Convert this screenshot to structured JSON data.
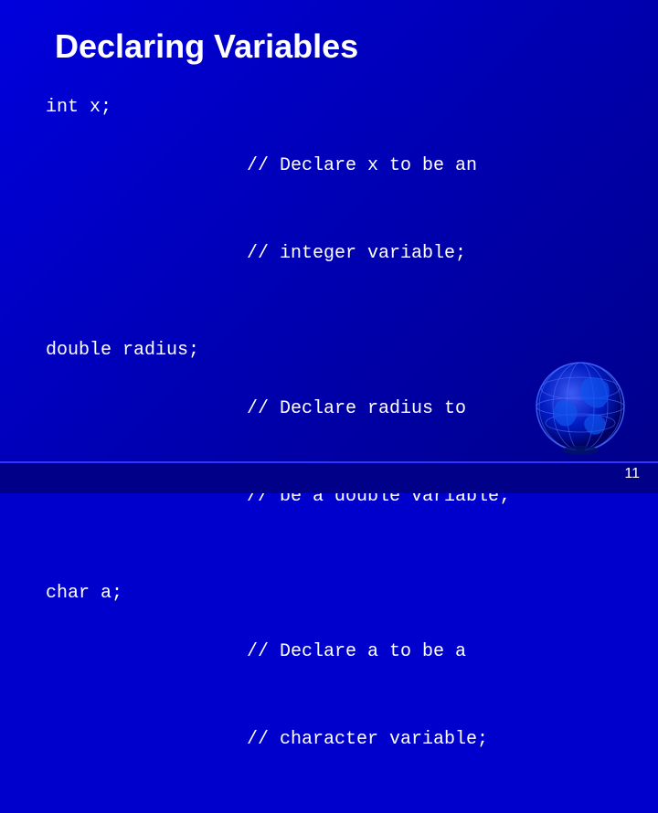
{
  "slide": {
    "title": "Declaring Variables",
    "rows": [
      {
        "code": "int x;",
        "comment_line1": "// Declare x to be an",
        "comment_line2": "// integer variable;"
      },
      {
        "code": "double radius;",
        "comment_line1": "// Declare radius to",
        "comment_line2": "// be a double variable;"
      },
      {
        "code": "char a;",
        "comment_line1": "// Declare a to be a",
        "comment_line2": "// character variable;"
      }
    ],
    "page_number": "11"
  }
}
